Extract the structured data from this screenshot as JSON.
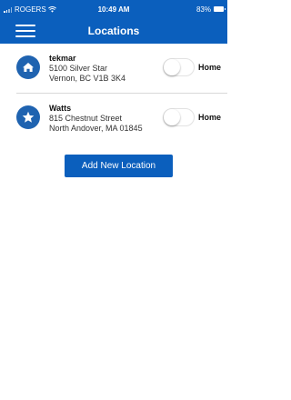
{
  "status_bar": {
    "carrier": "ROGERS",
    "time": "10:49 AM",
    "battery": "83%"
  },
  "nav": {
    "title": "Locations",
    "menu_icon": "hamburger-icon"
  },
  "locations": [
    {
      "name": "tekmar",
      "address_line1": "5100 Silver Star",
      "address_line2": "Vernon, BC V1B 3K4",
      "icon": "home-icon",
      "home_label": "Home",
      "home_enabled": false
    },
    {
      "name": "Watts",
      "address_line1": "815 Chestnut Street",
      "address_line2": "North Andover, MA 01845",
      "icon": "star-icon",
      "home_label": "Home",
      "home_enabled": false
    }
  ],
  "actions": {
    "add_location_label": "Add New Location"
  },
  "colors": {
    "primary": "#0b5fbd",
    "icon_bg": "#1f63b0"
  }
}
